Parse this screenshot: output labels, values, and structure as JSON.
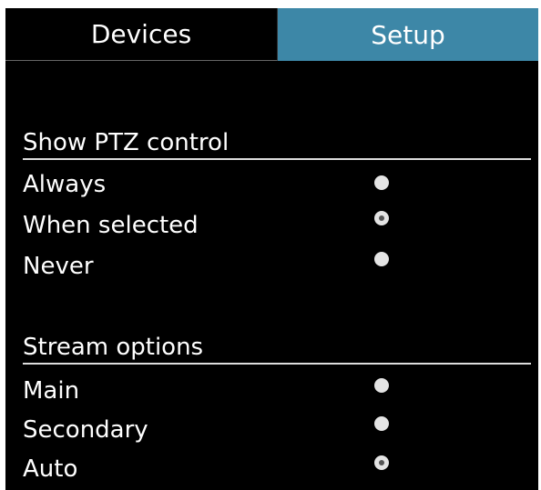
{
  "tabs": {
    "devices_label": "Devices",
    "setup_label": "Setup",
    "active": "Setup"
  },
  "ptz": {
    "title": "Show PTZ control",
    "options": [
      {
        "label": "Always",
        "selected": false
      },
      {
        "label": "When selected",
        "selected": true
      },
      {
        "label": "Never",
        "selected": false
      }
    ]
  },
  "stream": {
    "title": "Stream options",
    "options": [
      {
        "label": "Main",
        "selected": false
      },
      {
        "label": "Secondary",
        "selected": false
      },
      {
        "label": "Auto",
        "selected": true
      }
    ]
  },
  "colors": {
    "background": "#000000",
    "active_tab": "#3d87a7",
    "text": "#ffffff"
  }
}
